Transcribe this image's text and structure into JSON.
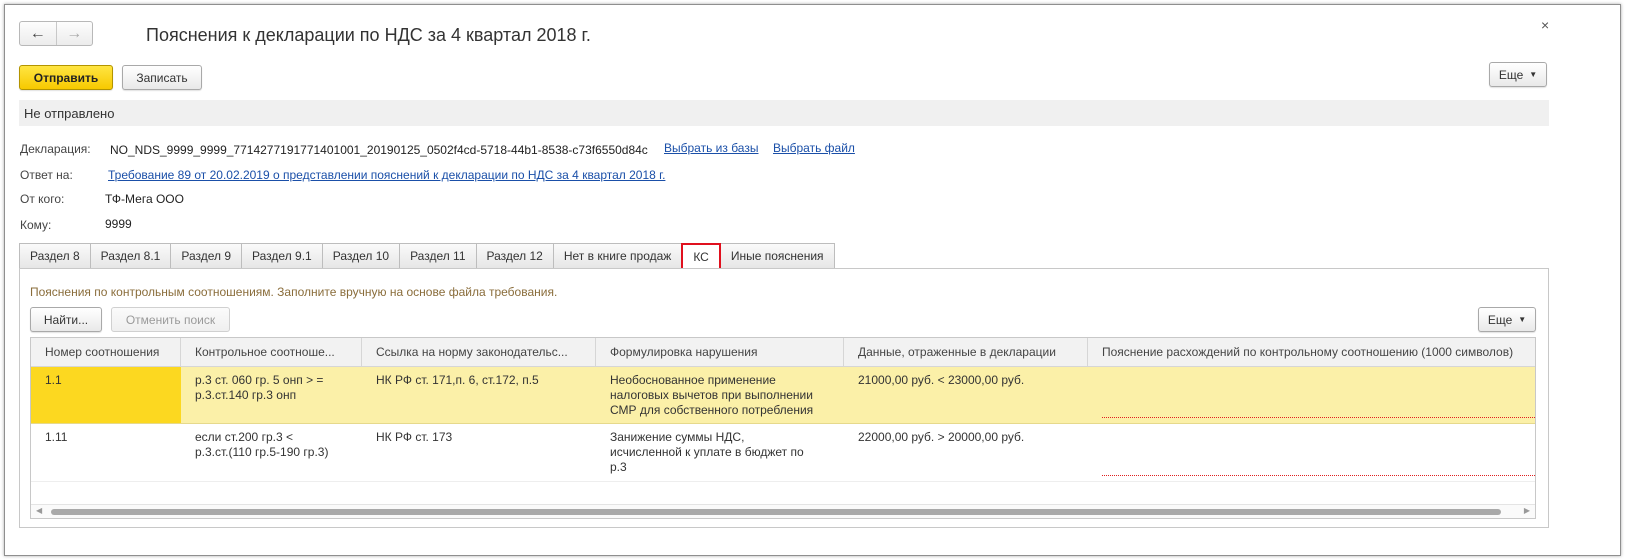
{
  "header": {
    "title": "Пояснения к декларации по НДС за 4 квартал 2018 г.",
    "back_icon": "arrow-left",
    "forward_icon": "arrow-right",
    "close_glyph": "×"
  },
  "toolbar": {
    "send_label": "Отправить",
    "save_label": "Записать",
    "more_label": "Еще"
  },
  "status": "Не отправлено",
  "fields": {
    "declaration_label": "Декларация:",
    "declaration_value": "NO_NDS_9999_9999_7714277191771401001_20190125_0502f4cd-5718-44b1-8538-c73f6550d84c",
    "select_from_base": "Выбрать из базы",
    "select_file": "Выбрать файл",
    "reply_label": "Ответ на:",
    "reply_link": "Требование 89 от 20.02.2019 о представлении пояснений к декларации по НДС за 4 квартал 2018 г.",
    "from_label": "От кого:",
    "from_value": "ТФ-Мега ООО",
    "to_label": "Кому:",
    "to_value": "9999"
  },
  "tabs": [
    {
      "label": "Раздел 8"
    },
    {
      "label": "Раздел 8.1"
    },
    {
      "label": "Раздел 9"
    },
    {
      "label": "Раздел 9.1"
    },
    {
      "label": "Раздел 10"
    },
    {
      "label": "Раздел 11"
    },
    {
      "label": "Раздел 12"
    },
    {
      "label": "Нет в книге продаж"
    },
    {
      "label": "КС",
      "active": true
    },
    {
      "label": "Иные пояснения"
    }
  ],
  "panel": {
    "hint": "Пояснения по контрольным соотношениям. Заполните вручную на основе файла требования.",
    "find_label": "Найти...",
    "cancel_search_label": "Отменить поиск",
    "more_label": "Еще"
  },
  "table": {
    "columns": [
      "Номер соотношения",
      "Контрольное соотноше...",
      "Ссылка на норму законодательс...",
      "Формулировка нарушения",
      "Данные, отраженные в декларации",
      "Пояснение расхождений по контрольному соотношению (1000 символов)"
    ],
    "rows": [
      [
        "1.1",
        "р.3 ст. 060 гр. 5 онп > =\nр.3.ст.140 гр.3 онп",
        "НК РФ ст. 171,п. 6, ст.172, п.5",
        "Необоснованное применение\nналоговых вычетов при выполнении\nСМР для собственного потребления",
        "21000,00 руб. < 23000,00 руб.",
        ""
      ],
      [
        "1.11",
        "если ст.200 гр.3 <\nр.3.ст.(110 гр.5-190 гр.3)",
        "НК РФ ст. 173",
        "Занижение суммы НДС,\nисчисленной к уплате в бюджет по\nр.3",
        "22000,00 руб. > 20000,00 руб.",
        ""
      ]
    ]
  },
  "colors": {
    "accent_yellow": "#f7c900",
    "selected_row": "#fbf0a8",
    "selected_cell": "#fcd820",
    "active_tab_border": "#e0101e",
    "link": "#1a4fa8"
  }
}
